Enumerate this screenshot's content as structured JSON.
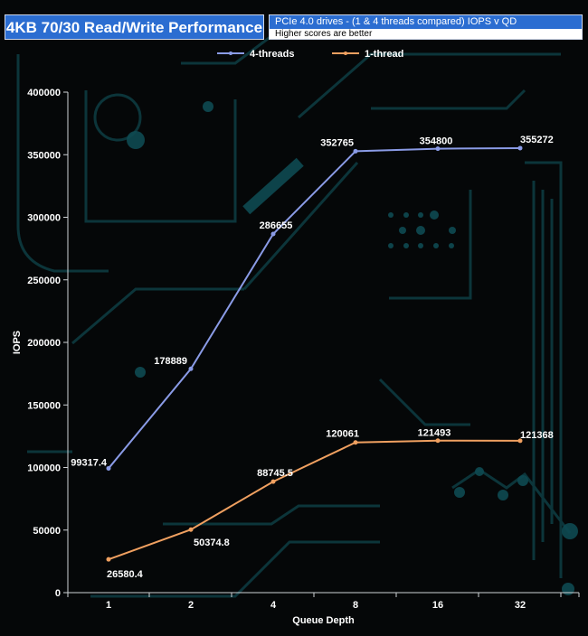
{
  "header": {
    "title": "4KB 70/30 Read/Write Performance",
    "subtitle": "PCIe 4.0 drives - (1 & 4 threads compared) IOPS v QD",
    "note": "Higher scores are better"
  },
  "chart_data": {
    "type": "line",
    "categories": [
      "1",
      "2",
      "4",
      "8",
      "16",
      "32"
    ],
    "series": [
      {
        "name": "4-threads",
        "color": "#8a9be6",
        "values": [
          99317.4,
          178889,
          286655,
          352765,
          354800,
          355272
        ],
        "labels": [
          "99317.4",
          "178889",
          "286655",
          "352765",
          "354800",
          "355272"
        ]
      },
      {
        "name": "1-thread",
        "color": "#f0a060",
        "values": [
          26580.4,
          50374.8,
          88745.5,
          120061,
          121493,
          121368
        ],
        "labels": [
          "26580.4",
          "50374.8",
          "88745.5",
          "120061",
          "121493",
          "121368"
        ]
      }
    ],
    "xlabel": "Queue Depth",
    "ylabel": "IOPS",
    "ylim": [
      0,
      400000
    ],
    "yticks": [
      0,
      50000,
      100000,
      150000,
      200000,
      250000,
      300000,
      350000,
      400000
    ],
    "legend_position": "top",
    "grid": false
  }
}
